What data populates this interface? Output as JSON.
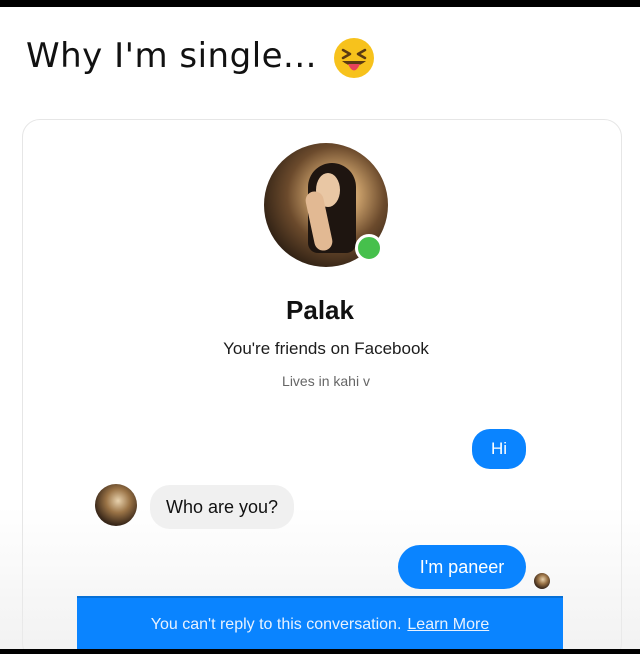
{
  "caption": {
    "text": "Why I'm single...",
    "emoji_name": "squinting-face-with-tongue-icon"
  },
  "profile": {
    "name": "Palak",
    "friend_status": "You're friends on Facebook",
    "location": "Lives in kahi v",
    "online": true
  },
  "messages": [
    {
      "direction": "outgoing",
      "text": "Hi"
    },
    {
      "direction": "incoming",
      "text": "Who are you?"
    },
    {
      "direction": "outgoing",
      "text": "I'm paneer"
    }
  ],
  "notice": {
    "text": "You can't reply to this conversation.",
    "link_label": "Learn More"
  },
  "colors": {
    "messenger_blue": "#0a84ff",
    "online_green": "#46c04c",
    "incoming_bubble": "#f0f0f0"
  }
}
